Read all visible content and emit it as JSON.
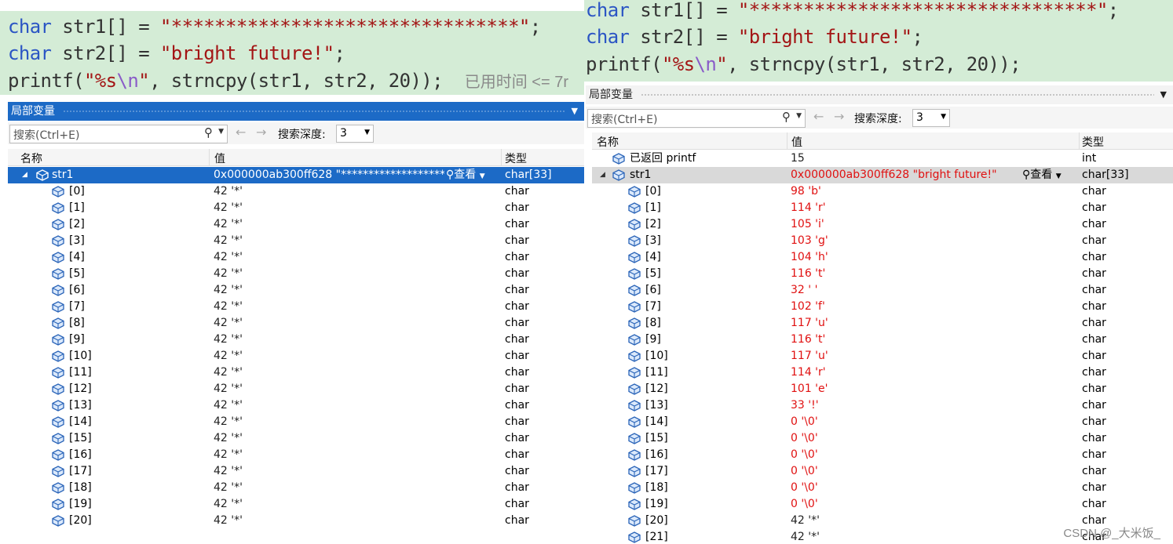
{
  "left": {
    "code": {
      "line1": {
        "kw": "char",
        "decl": " str1[] = ",
        "str": "\"********************************\"",
        "end": ";"
      },
      "line2": {
        "kw": "char",
        "decl": " str2[] = ",
        "str": "\"bright future!\"",
        "end": ";"
      },
      "line3": {
        "fn": "printf(",
        "str_a": "\"%s",
        "esc": "\\n",
        "str_b": "\"",
        "rest": ", strncpy(str1, str2, 20));",
        "ghost": "已用时间 <= 7r"
      }
    },
    "title": "局部变量",
    "search_placeholder": "搜索(Ctrl+E)",
    "depth_label": "搜索深度:",
    "depth_value": "3",
    "columns": {
      "name": "名称",
      "value": "值",
      "type": "类型"
    },
    "root": {
      "name": "str1",
      "value": "0x000000ab300ff628 \"********************************...",
      "lookup": "查看",
      "type": "char[33]"
    },
    "rows": [
      {
        "name": "[0]",
        "value": "42 '*'",
        "type": "char"
      },
      {
        "name": "[1]",
        "value": "42 '*'",
        "type": "char"
      },
      {
        "name": "[2]",
        "value": "42 '*'",
        "type": "char"
      },
      {
        "name": "[3]",
        "value": "42 '*'",
        "type": "char"
      },
      {
        "name": "[4]",
        "value": "42 '*'",
        "type": "char"
      },
      {
        "name": "[5]",
        "value": "42 '*'",
        "type": "char"
      },
      {
        "name": "[6]",
        "value": "42 '*'",
        "type": "char"
      },
      {
        "name": "[7]",
        "value": "42 '*'",
        "type": "char"
      },
      {
        "name": "[8]",
        "value": "42 '*'",
        "type": "char"
      },
      {
        "name": "[9]",
        "value": "42 '*'",
        "type": "char"
      },
      {
        "name": "[10]",
        "value": "42 '*'",
        "type": "char"
      },
      {
        "name": "[11]",
        "value": "42 '*'",
        "type": "char"
      },
      {
        "name": "[12]",
        "value": "42 '*'",
        "type": "char"
      },
      {
        "name": "[13]",
        "value": "42 '*'",
        "type": "char"
      },
      {
        "name": "[14]",
        "value": "42 '*'",
        "type": "char"
      },
      {
        "name": "[15]",
        "value": "42 '*'",
        "type": "char"
      },
      {
        "name": "[16]",
        "value": "42 '*'",
        "type": "char"
      },
      {
        "name": "[17]",
        "value": "42 '*'",
        "type": "char"
      },
      {
        "name": "[18]",
        "value": "42 '*'",
        "type": "char"
      },
      {
        "name": "[19]",
        "value": "42 '*'",
        "type": "char"
      },
      {
        "name": "[20]",
        "value": "42 '*'",
        "type": "char"
      }
    ]
  },
  "right": {
    "code": {
      "line1": {
        "kw": "char",
        "decl": " str1[] = ",
        "str": "\"********************************\"",
        "end": ";"
      },
      "line2": {
        "kw": "char",
        "decl": " str2[] = ",
        "str": "\"bright future!\"",
        "end": ";"
      },
      "line3": {
        "fn": "printf(",
        "str_a": "\"%s",
        "esc": "\\n",
        "str_b": "\"",
        "rest": ", strncpy(str1, str2, 20));"
      }
    },
    "title": "局部变量",
    "search_placeholder": "搜索(Ctrl+E)",
    "depth_label": "搜索深度:",
    "depth_value": "3",
    "columns": {
      "name": "名称",
      "value": "值",
      "type": "类型"
    },
    "returned": {
      "name": "已返回 printf",
      "value": "15",
      "type": "int"
    },
    "root": {
      "name": "str1",
      "value": "0x000000ab300ff628 \"bright future!\"",
      "lookup": "查看",
      "type": "char[33]"
    },
    "rows": [
      {
        "name": "[0]",
        "value": "98 'b'",
        "type": "char",
        "changed": true
      },
      {
        "name": "[1]",
        "value": "114 'r'",
        "type": "char",
        "changed": true
      },
      {
        "name": "[2]",
        "value": "105 'i'",
        "type": "char",
        "changed": true
      },
      {
        "name": "[3]",
        "value": "103 'g'",
        "type": "char",
        "changed": true
      },
      {
        "name": "[4]",
        "value": "104 'h'",
        "type": "char",
        "changed": true
      },
      {
        "name": "[5]",
        "value": "116 't'",
        "type": "char",
        "changed": true
      },
      {
        "name": "[6]",
        "value": "32 ' '",
        "type": "char",
        "changed": true
      },
      {
        "name": "[7]",
        "value": "102 'f'",
        "type": "char",
        "changed": true
      },
      {
        "name": "[8]",
        "value": "117 'u'",
        "type": "char",
        "changed": true
      },
      {
        "name": "[9]",
        "value": "116 't'",
        "type": "char",
        "changed": true
      },
      {
        "name": "[10]",
        "value": "117 'u'",
        "type": "char",
        "changed": true
      },
      {
        "name": "[11]",
        "value": "114 'r'",
        "type": "char",
        "changed": true
      },
      {
        "name": "[12]",
        "value": "101 'e'",
        "type": "char",
        "changed": true
      },
      {
        "name": "[13]",
        "value": "33 '!'",
        "type": "char",
        "changed": true
      },
      {
        "name": "[14]",
        "value": "0 '\\0'",
        "type": "char",
        "changed": true
      },
      {
        "name": "[15]",
        "value": "0 '\\0'",
        "type": "char",
        "changed": true
      },
      {
        "name": "[16]",
        "value": "0 '\\0'",
        "type": "char",
        "changed": true
      },
      {
        "name": "[17]",
        "value": "0 '\\0'",
        "type": "char",
        "changed": true
      },
      {
        "name": "[18]",
        "value": "0 '\\0'",
        "type": "char",
        "changed": true
      },
      {
        "name": "[19]",
        "value": "0 '\\0'",
        "type": "char",
        "changed": true
      },
      {
        "name": "[20]",
        "value": "42 '*'",
        "type": "char",
        "changed": false
      },
      {
        "name": "[21]",
        "value": "42 '*'",
        "type": "char",
        "changed": false
      }
    ]
  },
  "watermark": "CSDN @_大米饭_",
  "colors": {
    "selection": "#1c6ac6",
    "changed_value": "#e01010",
    "code_bg": "#d4ecd6",
    "keyword": "#2b55c4",
    "string": "#a31515"
  },
  "icons": {
    "variable": "cube-icon",
    "search": "magnifier-icon",
    "back": "arrow-left-icon",
    "forward": "arrow-right-icon",
    "expand": "collapse-triangle-icon",
    "dropdown": "chevron-down-icon"
  }
}
